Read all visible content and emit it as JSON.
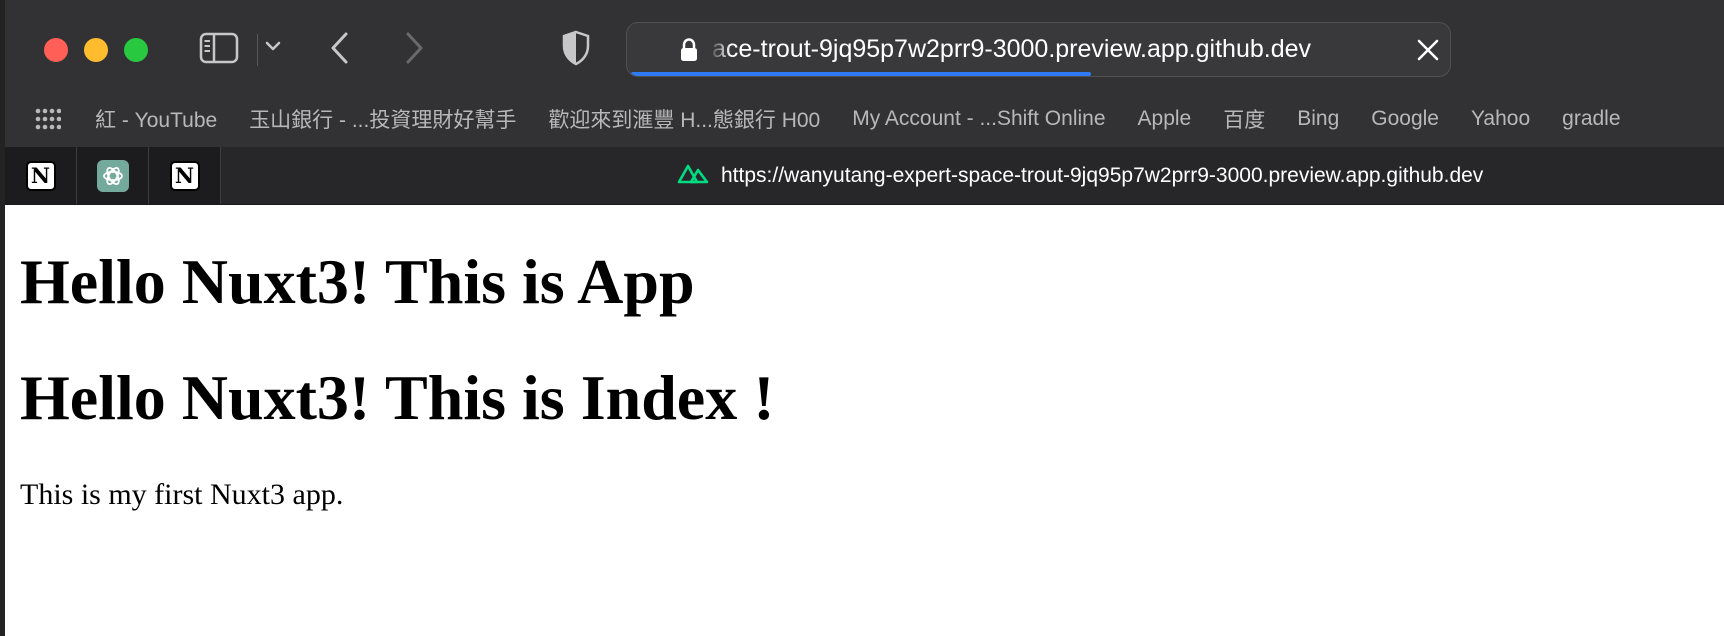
{
  "window": {
    "controls": [
      "close",
      "minimize",
      "zoom"
    ]
  },
  "toolbar": {
    "icons": [
      "sidebar-icon",
      "chevron-down-icon",
      "back-icon",
      "forward-icon",
      "shield-icon"
    ],
    "url_visible": "ace-trout-9jq95p7w2prr9-3000.preview.app.github.dev",
    "url_close_icon": "close-icon",
    "accent": "#2f7bf6"
  },
  "favorites": {
    "grid_icon": "grid-icon",
    "items": [
      "紅 - YouTube",
      "玉山銀行 - ...投資理財好幫手",
      "歡迎來到滙豐 H...態銀行 H00",
      "My Account - ...Shift Online",
      "Apple",
      "百度",
      "Bing",
      "Google",
      "Yahoo",
      "gradle"
    ]
  },
  "tabs": {
    "pinned": [
      "notion-icon",
      "chatgpt-icon",
      "notion-icon"
    ],
    "active": {
      "favicon": "nuxt-icon",
      "title": "https://wanyutang-expert-space-trout-9jq95p7w2prr9-3000.preview.app.github.dev"
    }
  },
  "page": {
    "heading_app": "Hello Nuxt3! This is App",
    "heading_index": "Hello Nuxt3! This is Index !",
    "paragraph": "This is my first Nuxt3 app."
  }
}
